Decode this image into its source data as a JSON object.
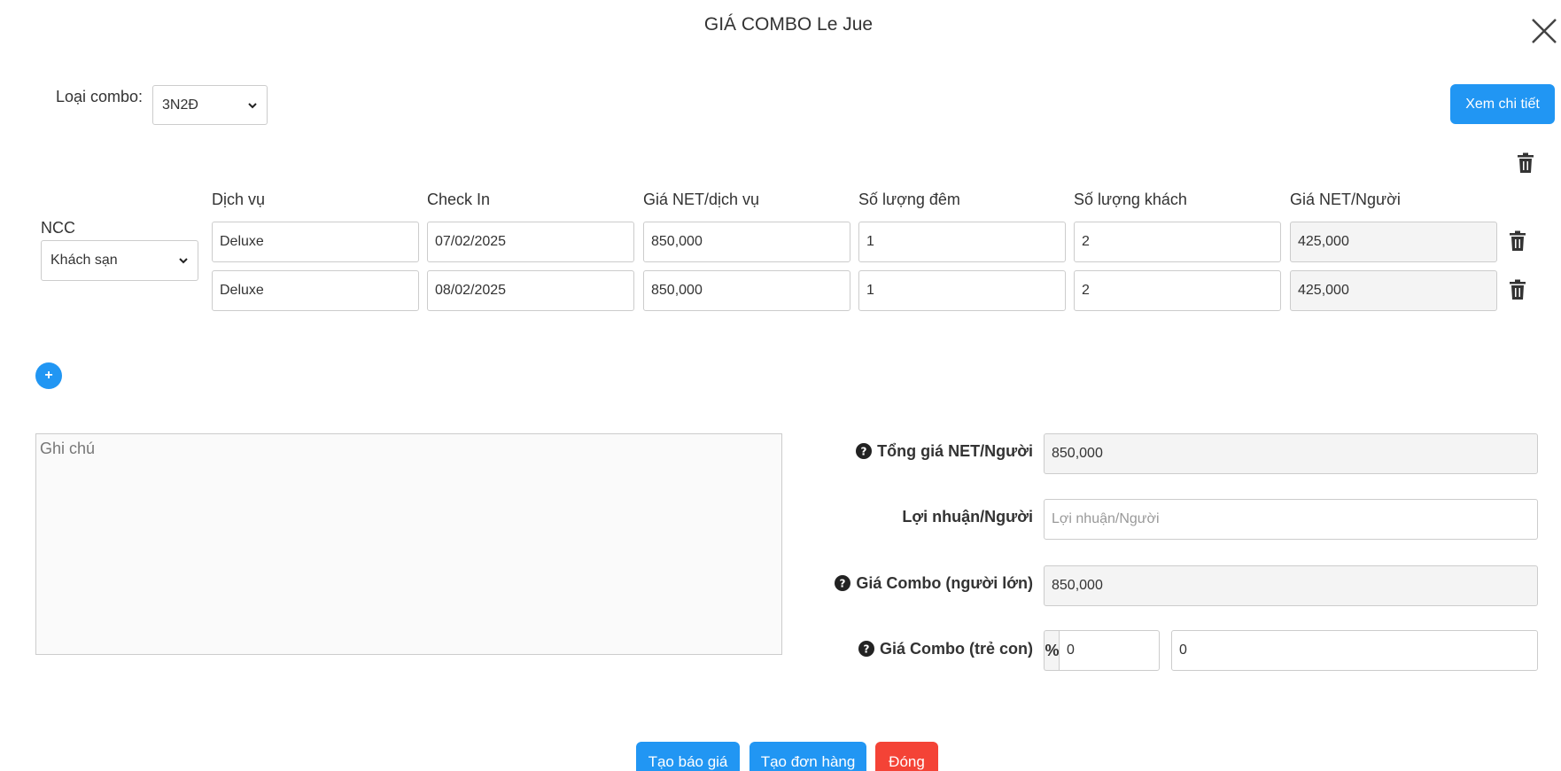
{
  "modal": {
    "title": "GIÁ COMBO Le Jue"
  },
  "combo": {
    "label": "Loại combo:",
    "selected": "3N2Đ"
  },
  "detail_button": "Xem chi tiết",
  "table": {
    "ncc_label": "NCC",
    "ncc_selected": "Khách sạn",
    "headers": [
      "Dịch vụ",
      "Check In",
      "Giá NET/dịch vụ",
      "Số lượng đêm",
      "Số lượng khách",
      "Giá NET/Người"
    ],
    "rows": [
      {
        "service": "Deluxe",
        "check_in": "07/02/2025",
        "net_price": "850,000",
        "nights": "1",
        "guests": "2",
        "net_per_person": "425,000"
      },
      {
        "service": "Deluxe",
        "check_in": "08/02/2025",
        "net_price": "850,000",
        "nights": "1",
        "guests": "2",
        "net_per_person": "425,000"
      }
    ]
  },
  "add_button": "+",
  "notes": {
    "placeholder": "Ghi chú"
  },
  "summary": {
    "total_net_label": "Tổng giá NET/Người",
    "total_net_value": "850,000",
    "profit_label": "Lợi nhuận/Người",
    "profit_placeholder": "Lợi nhuận/Người",
    "adult_label": "Giá Combo (người lớn)",
    "adult_value": "850,000",
    "child_label": "Giá Combo (trẻ con)",
    "child_percent_symbol": "%",
    "child_percent_value": "0",
    "child_value": "0"
  },
  "footer": {
    "quote_button": "Tạo báo giá",
    "order_button": "Tạo đơn hàng",
    "close_button": "Đóng"
  },
  "colors": {
    "primary": "#2196F3",
    "danger": "#F44336"
  }
}
